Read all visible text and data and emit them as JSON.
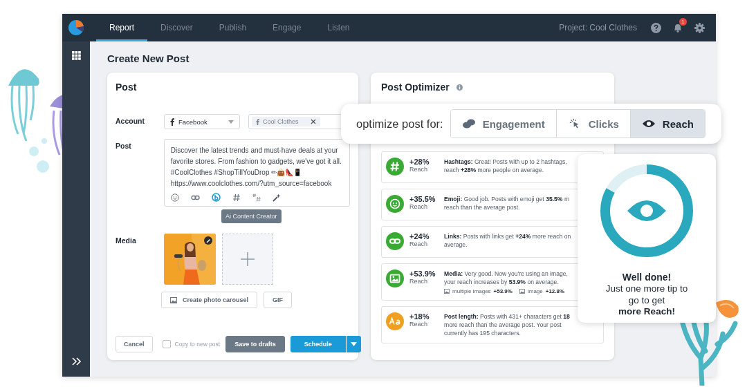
{
  "nav": {
    "tabs": [
      {
        "label": "Report",
        "selected": true
      },
      {
        "label": "Discover",
        "selected": false
      },
      {
        "label": "Publish",
        "selected": false
      },
      {
        "label": "Engage",
        "selected": false
      },
      {
        "label": "Listen",
        "selected": false
      }
    ],
    "project": "Project: Cool Clothes",
    "notifications": "1"
  },
  "page_title": "Create New Post",
  "post_card": {
    "title": "Post",
    "account_label": "Account",
    "account_select": "Facebook",
    "profile_tag": "Cool Clothes",
    "post_label": "Post",
    "post_text": "Discover the latest trends and must-have deals at your favorite stores. From fashion to gadgets, we've got it all. #CoolClothes #ShopTillYouDrop ✏👜👠📱\nhttps://www.coolclothes.com/?utm_source=facebook",
    "tooltip": "Ai Content Creator",
    "media_label": "Media",
    "carousel_button": "Create photo carousel",
    "gif_button": "GIF",
    "cancel_button": "Cancel",
    "copy_label": "Copy to new post",
    "copy_checked": false,
    "save_button": "Save to drafts",
    "schedule_button": "Schedule"
  },
  "optimizer": {
    "title": "Post Optimizer",
    "prompt": "optimize post for:",
    "goals": [
      {
        "kind": "engagement",
        "label": "Engagement",
        "selected": false
      },
      {
        "kind": "clicks",
        "label": "Clicks",
        "selected": false
      },
      {
        "kind": "reach",
        "label": "Reach",
        "selected": true
      }
    ],
    "tips": [
      {
        "kind": "hashtag",
        "color": "#3aaa35",
        "percent": "+28%",
        "metric": "Reach",
        "lines": [
          "**Hashtags:** Great! Posts with up to 2 hashtags,",
          "reach **+28%** more people on average."
        ]
      },
      {
        "kind": "emoji",
        "color": "#3aaa35",
        "percent": "+35.5%",
        "metric": "Reach",
        "lines": [
          "**Emoji:** Good job. Posts with emoji get **35.5%** m",
          "reach than the average post."
        ]
      },
      {
        "kind": "link",
        "color": "#3aaa35",
        "percent": "+24%",
        "metric": "Reach",
        "lines": [
          "**Links:** Posts with links get **+24%** more reach on",
          "average."
        ]
      },
      {
        "kind": "media",
        "color": "#3aaa35",
        "percent": "+53.9%",
        "metric": "Reach",
        "lines": [
          "**Media:** Very good. Now you're using an image,",
          "your reach increases by **53.9%** on average."
        ],
        "extras": [
          {
            "label": "multiple images",
            "value": "+53.9%"
          },
          {
            "label": "image",
            "value": "+12.8%"
          }
        ]
      },
      {
        "kind": "text",
        "color": "#f0a020",
        "percent": "+18%",
        "metric": "Reach",
        "lines": [
          "**Post length:** Posts with 431+ characters get **18**",
          "more reach than the average post. Your post",
          "currently has 195 characters."
        ]
      }
    ]
  },
  "score_card": {
    "level": 0.83,
    "heading": "Well done!",
    "body": "Just one more tip to go to get",
    "emphasis": "more Reach!"
  }
}
